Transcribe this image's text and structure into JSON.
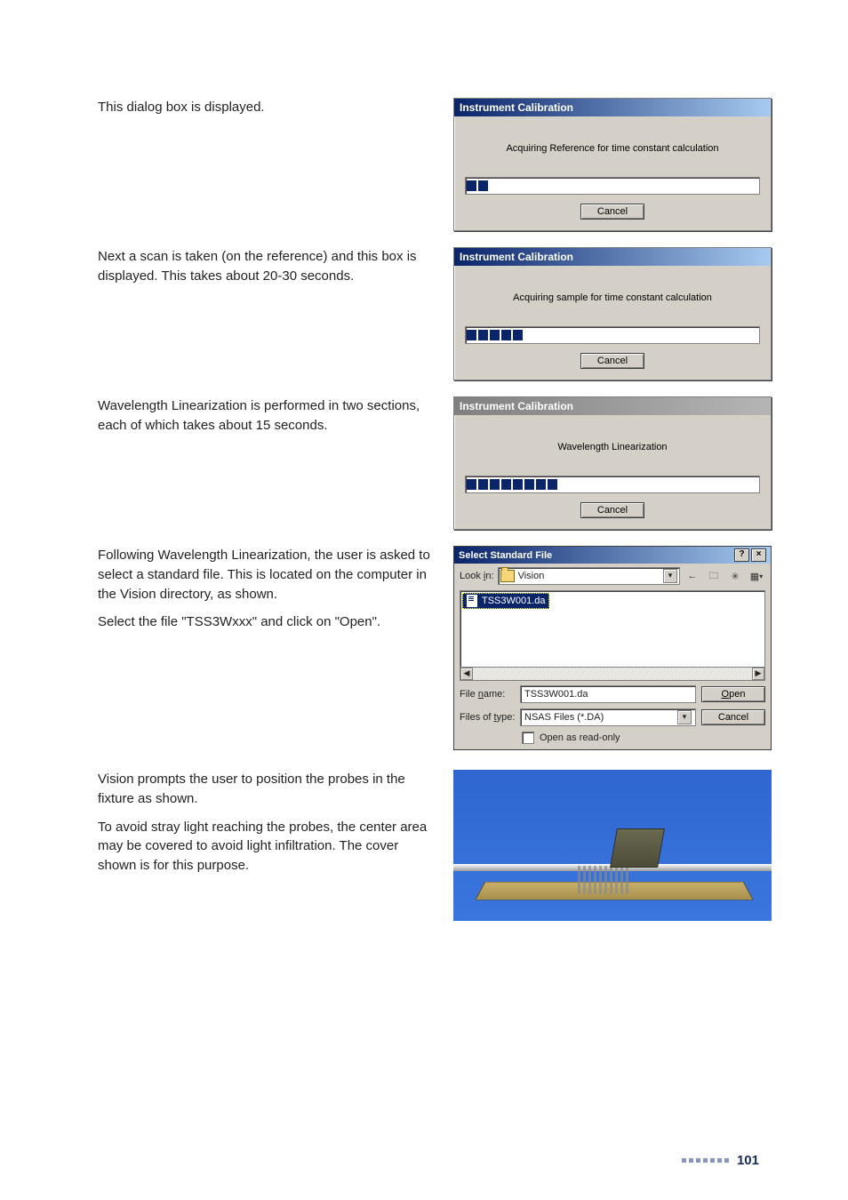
{
  "paragraphs": {
    "p1": "This dialog box is displayed.",
    "p2": "Next a scan is taken (on the reference) and this box is displayed. This takes about 20-30 seconds.",
    "p3": "Wavelength Linearization is performed in two sections, each of which takes about 15 seconds.",
    "p4a": "Following Wavelength Linearization, the user is asked to select a standard file. This is located on the computer in the Vision directory, as shown.",
    "p4b": "Select the file \"TSS3Wxxx\" and click on \"Open\".",
    "p5a": "Vision prompts the user to position the probes in the fixture as shown.",
    "p5b": "To avoid stray light reaching the probes, the center area may be covered to avoid light infiltration. The cover shown is for this purpose."
  },
  "dlg1": {
    "title": "Instrument Calibration",
    "msg": "Acquiring Reference for time constant calculation",
    "blocks": 2,
    "cancel": "Cancel"
  },
  "dlg2": {
    "title": "Instrument Calibration",
    "msg": "Acquiring sample for time constant calculation",
    "blocks": 5,
    "cancel": "Cancel"
  },
  "dlg3": {
    "title": "Instrument Calibration",
    "msg": "Wavelength Linearization",
    "blocks": 8,
    "cancel": "Cancel"
  },
  "file": {
    "title": "Select Standard File",
    "lookin_label": "Look in:",
    "lookin_value": "Vision",
    "item": "TSS3W001.da",
    "filename_label": "File name:",
    "filename_value": "TSS3W001.da",
    "filetype_label": "Files of type:",
    "filetype_value": "NSAS Files (*.DA)",
    "open": "Open",
    "cancel": "Cancel",
    "readonly": "Open as read-only",
    "help_glyph": "?",
    "close_glyph": "×",
    "back_glyph": "←",
    "up_glyph": "🗀",
    "new_glyph": "✳",
    "view_glyph": "▦",
    "dd_glyph": "▾",
    "scroll_left": "◀",
    "scroll_right": "▶"
  },
  "page_number": "101"
}
